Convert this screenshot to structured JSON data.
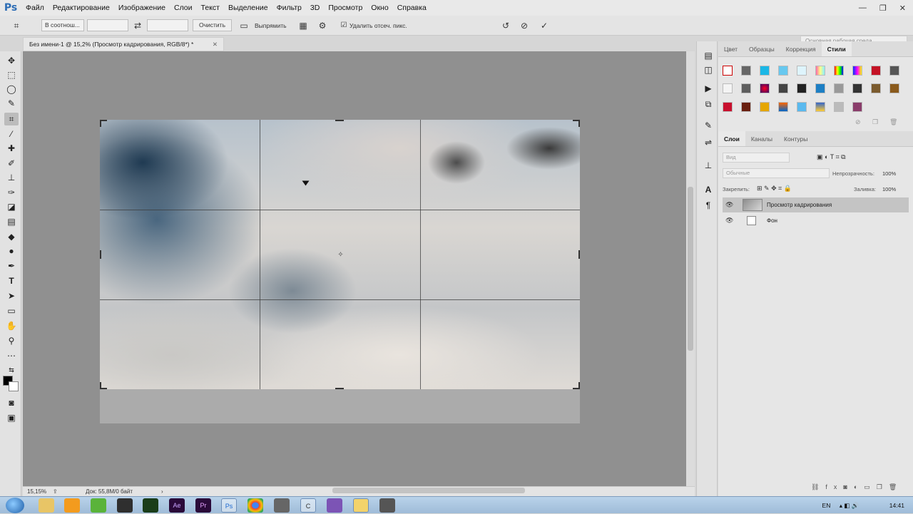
{
  "app": {
    "logo": "Ps"
  },
  "menu": [
    "Файл",
    "Редактирование",
    "Изображение",
    "Слои",
    "Текст",
    "Выделение",
    "Фильтр",
    "3D",
    "Просмотр",
    "Окно",
    "Справка"
  ],
  "options": {
    "ratio_select": "В соотнош...",
    "clear_label": "Очистить",
    "straighten_label": "Выпрямить",
    "delete_pixels_label": "Удалить отсеч. пикс.",
    "delete_pixels_checked": true,
    "workspace": "Основная рабочая среда"
  },
  "document": {
    "tab_title": "Без имени-1 @ 15,2% (Просмотр кадрирования, RGB/8*) *",
    "zoom": "15,15%",
    "doc_info": "Док: 55,8M/0 байт"
  },
  "panels": {
    "top_tabs": [
      "Цвет",
      "Образцы",
      "Коррекция",
      "Стили"
    ],
    "top_active": "Стили",
    "layer_tabs": [
      "Слои",
      "Каналы",
      "Контуры"
    ],
    "layer_active": "Слои",
    "kind_placeholder": "Вид",
    "blend_mode": "Обычные",
    "opacity_label": "Непрозрачность:",
    "opacity_value": "100%",
    "lock_label": "Закрепить:",
    "fill_label": "Заливка:",
    "fill_value": "100%",
    "layers": [
      {
        "name": "Просмотр кадрирования",
        "selected": true
      },
      {
        "name": "Фон",
        "selected": false
      }
    ]
  },
  "taskbar": {
    "lang": "EN",
    "time": "14:41",
    "apps": [
      "explorer-icon",
      "media-icon",
      "utorrent-icon",
      "nvidia-icon",
      "ae-icon",
      "premiere-icon",
      "ps-icon",
      "chrome-icon",
      "files-icon",
      "ccleaner-icon",
      "viber-icon",
      "folder-icon",
      "calculator-icon"
    ]
  }
}
